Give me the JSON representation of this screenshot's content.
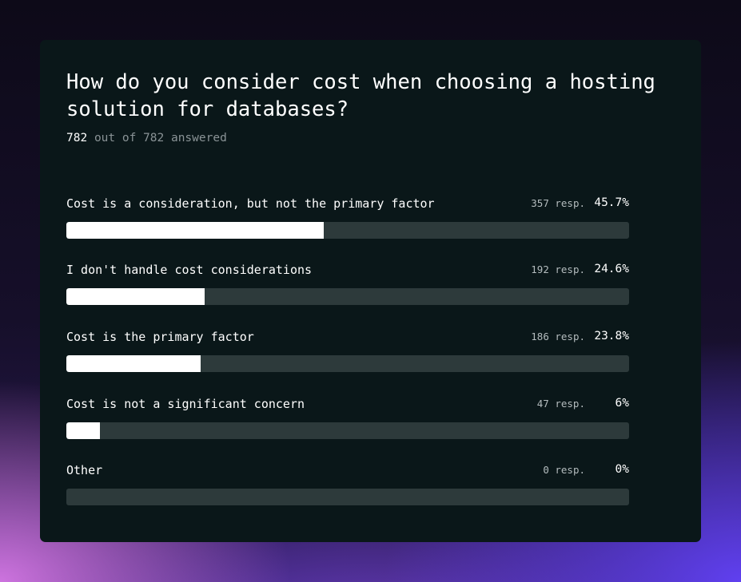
{
  "poll": {
    "question": "How do you consider cost when choosing a hosting solution for databases?",
    "answered_count": "782",
    "answered_rest": "out of 782 answered"
  },
  "colors": {
    "card_background": "#0a1719",
    "bar_track": "#2d3a3b",
    "bar_fill": "#ffffff"
  },
  "options": [
    {
      "label": "Cost is a consideration, but not the primary factor",
      "responses": "357 resp.",
      "percent": "45.7%"
    },
    {
      "label": "I don't handle cost considerations",
      "responses": "192 resp.",
      "percent": "24.6%"
    },
    {
      "label": "Cost is the primary factor",
      "responses": "186 resp.",
      "percent": "23.8%"
    },
    {
      "label": "Cost is not a significant concern",
      "responses": "47 resp.",
      "percent": "6%"
    },
    {
      "label": "Other",
      "responses": "0 resp.",
      "percent": "0%"
    }
  ],
  "chart_data": {
    "type": "bar",
    "orientation": "horizontal",
    "categories": [
      "Cost is a consideration, but not the primary factor",
      "I don't handle cost considerations",
      "Cost is the primary factor",
      "Cost is not a significant concern",
      "Other"
    ],
    "values": [
      45.7,
      24.6,
      23.8,
      6,
      0
    ],
    "responses": [
      357,
      192,
      186,
      47,
      0
    ],
    "xlim": [
      0,
      100
    ],
    "grid": false,
    "title": "How do you consider cost when choosing a hosting solution for databases?"
  }
}
